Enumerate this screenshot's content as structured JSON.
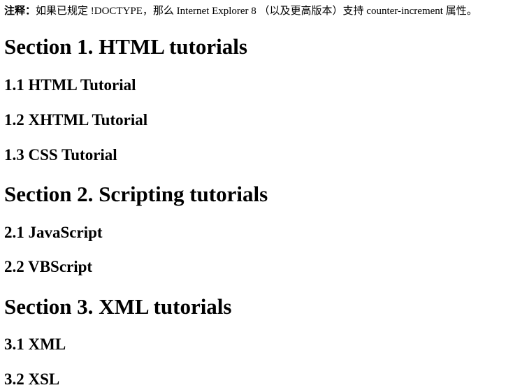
{
  "note": {
    "label": "注释：",
    "text": "如果已规定 !DOCTYPE，那么 Internet Explorer 8 （以及更高版本）支持 counter-increment 属性。"
  },
  "sections": [
    {
      "number": "Section 1.",
      "title": "HTML tutorials",
      "items": [
        {
          "number": "1.1",
          "title": "HTML Tutorial"
        },
        {
          "number": "1.2",
          "title": "XHTML Tutorial"
        },
        {
          "number": "1.3",
          "title": "CSS Tutorial"
        }
      ]
    },
    {
      "number": "Section 2.",
      "title": "Scripting tutorials",
      "items": [
        {
          "number": "2.1",
          "title": "JavaScript"
        },
        {
          "number": "2.2",
          "title": "VBScript"
        }
      ]
    },
    {
      "number": "Section 3.",
      "title": "XML tutorials",
      "items": [
        {
          "number": "3.1",
          "title": "XML"
        },
        {
          "number": "3.2",
          "title": "XSL"
        }
      ]
    }
  ]
}
